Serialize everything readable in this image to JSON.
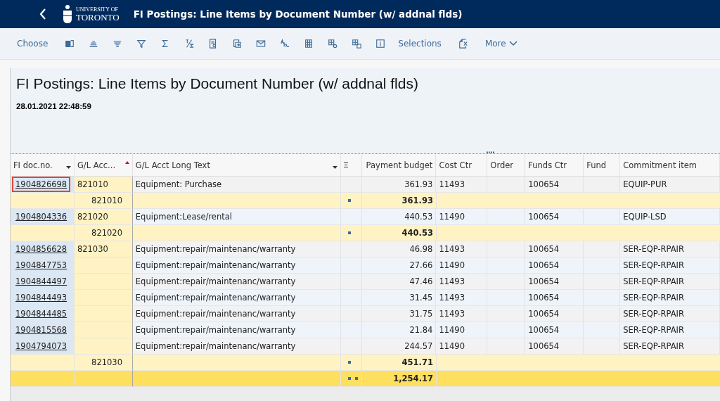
{
  "header": {
    "logo_small": "UNIVERSITY OF",
    "logo_large": "TORONTO",
    "title": "FI Postings: Line Items by Document Number (w/ addnal flds)"
  },
  "toolbar": {
    "choose": "Choose",
    "selections": "Selections",
    "more": "More"
  },
  "report": {
    "title": "FI Postings: Line Items by Document Number (w/ addnal flds)",
    "timestamp": "28.01.2021 22:48:59"
  },
  "table": {
    "columns": [
      {
        "label": "FI doc.no.",
        "kind": "filter"
      },
      {
        "label": "G/L Acc...",
        "kind": "sorted"
      },
      {
        "label": "G/L Acct Long Text",
        "kind": "filter"
      },
      {
        "kind": "sum"
      },
      {
        "label": "Payment budget",
        "kind": "plain"
      },
      {
        "label": "Cost Ctr",
        "kind": "plain"
      },
      {
        "label": "Order",
        "kind": "plain"
      },
      {
        "label": "Funds Ctr",
        "kind": "plain"
      },
      {
        "label": "Fund",
        "kind": "plain"
      },
      {
        "label": "Commitment item",
        "kind": "plain"
      }
    ],
    "rows": [
      {
        "kind": "item",
        "selected": true,
        "doc": "1904826698",
        "gl": "821010",
        "text": "Equipment:  Purchase",
        "amount": "361.93",
        "cost_ctr": "11493",
        "funds_ctr": "100654",
        "commitment": "EQUIP-PUR"
      },
      {
        "kind": "subtotal",
        "gl": "821010",
        "amount": "361.93"
      },
      {
        "kind": "item",
        "selected": false,
        "doc": "1904804336",
        "gl": "821020",
        "text": "Equipment:Lease/rental",
        "amount": "440.53",
        "cost_ctr": "11490",
        "funds_ctr": "100654",
        "commitment": "EQUIP-LSD"
      },
      {
        "kind": "subtotal",
        "gl": "821020",
        "amount": "440.53"
      },
      {
        "kind": "item",
        "selected": false,
        "doc": "1904856628",
        "gl": "821030",
        "text": "Equipment:repair/maintenanc/warranty",
        "amount": "46.98",
        "cost_ctr": "11493",
        "funds_ctr": "100654",
        "commitment": "SER-EQP-RPAIR"
      },
      {
        "kind": "item",
        "selected": false,
        "doc": "1904847753",
        "text": "Equipment:repair/maintenanc/warranty",
        "amount": "27.66",
        "cost_ctr": "11490",
        "funds_ctr": "100654",
        "commitment": "SER-EQP-RPAIR"
      },
      {
        "kind": "item",
        "selected": false,
        "doc": "1904844497",
        "text": "Equipment:repair/maintenanc/warranty",
        "amount": "47.46",
        "cost_ctr": "11493",
        "funds_ctr": "100654",
        "commitment": "SER-EQP-RPAIR"
      },
      {
        "kind": "item",
        "selected": false,
        "doc": "1904844493",
        "text": "Equipment:repair/maintenanc/warranty",
        "amount": "31.45",
        "cost_ctr": "11493",
        "funds_ctr": "100654",
        "commitment": "SER-EQP-RPAIR"
      },
      {
        "kind": "item",
        "selected": false,
        "doc": "1904844485",
        "text": "Equipment:repair/maintenanc/warranty",
        "amount": "31.75",
        "cost_ctr": "11493",
        "funds_ctr": "100654",
        "commitment": "SER-EQP-RPAIR"
      },
      {
        "kind": "item",
        "selected": false,
        "doc": "1904815568",
        "text": "Equipment:repair/maintenanc/warranty",
        "amount": "21.84",
        "cost_ctr": "11490",
        "funds_ctr": "100654",
        "commitment": "SER-EQP-RPAIR"
      },
      {
        "kind": "item",
        "selected": false,
        "doc": "1904794073",
        "text": "Equipment:repair/maintenanc/warranty",
        "amount": "244.57",
        "cost_ctr": "11490",
        "funds_ctr": "100654",
        "commitment": "SER-EQP-RPAIR"
      },
      {
        "kind": "subtotal",
        "gl": "821030",
        "amount": "451.71"
      },
      {
        "kind": "total",
        "amount": "1,254.17"
      }
    ]
  }
}
